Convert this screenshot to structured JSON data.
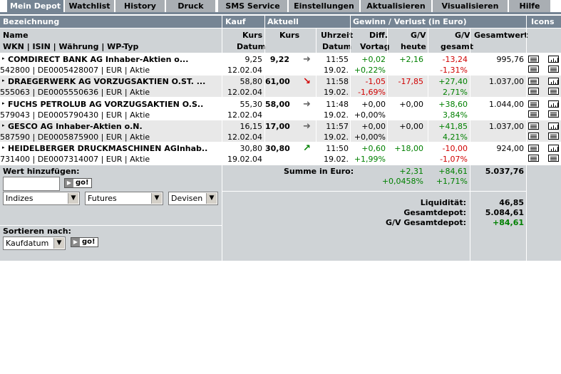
{
  "tabs": {
    "mein_depot": "Mein Depot",
    "watchlist": "Watchlist",
    "history": "History",
    "druck": "Druck",
    "sms": "SMS Service",
    "einstellungen": "Einstellungen",
    "aktualisieren": "Aktualisieren",
    "visualisieren": "Visualisieren",
    "hilfe": "Hilfe"
  },
  "header": {
    "bezeichnung": "Bezeichnung",
    "kauf": "Kauf",
    "aktuell": "Aktuell",
    "gewinn": "Gewinn / Verlust  (in Euro)",
    "icons": "Icons",
    "name": "Name",
    "wkn_line": "WKN | ISIN | Währung | WP-Typ",
    "kurs": "Kurs",
    "datum": "Datum",
    "kurs2": "Kurs",
    "uhrzeit": "Uhrzeit",
    "datum2": "Datum",
    "diff": "Diff.",
    "vortag": "Vortag",
    "gv": "G/V",
    "heute": "heute",
    "gv2": "G/V",
    "gesamt": "gesamt",
    "gesamtwert": "Gesamtwert"
  },
  "rows": [
    {
      "name": "COMDIRECT BANK AG Inhaber-Aktien o...",
      "ids": "542800 | DE0005428007 | EUR | Aktie",
      "kauf_kurs": "9,25",
      "kauf_datum": "12.02.04",
      "kurs": "9,22",
      "arrow": "right",
      "zeit": "11:55",
      "datum": "19.02.",
      "diff": "+0,02",
      "diff_pct": "+0,22%",
      "gv_heute": "+2,16",
      "gv_gesamt": "-13,24",
      "gv_pct": "-1,31%",
      "wert": "995,76"
    },
    {
      "name": "DRAEGERWERK AG VORZUGSAKTIEN O.ST. ...",
      "ids": "555063 | DE0005550636 | EUR | Aktie",
      "kauf_kurs": "58,80",
      "kauf_datum": "12.02.04",
      "kurs": "61,00",
      "arrow": "down",
      "zeit": "11:58",
      "datum": "19.02.",
      "diff": "-1,05",
      "diff_pct": "-1,69%",
      "gv_heute": "-17,85",
      "gv_gesamt": "+27,40",
      "gv_pct": "2,71%",
      "wert": "1.037,00"
    },
    {
      "name": "FUCHS PETROLUB AG VORZUGSAKTIEN O.S..",
      "ids": "579043 | DE0005790430 | EUR | Aktie",
      "kauf_kurs": "55,30",
      "kauf_datum": "12.02.04",
      "kurs": "58,00",
      "arrow": "right",
      "zeit": "11:48",
      "datum": "19.02.",
      "diff": "+0,00",
      "diff_pct": "+0,00%",
      "gv_heute": "+0,00",
      "gv_gesamt": "+38,60",
      "gv_pct": "3,84%",
      "wert": "1.044,00"
    },
    {
      "name": "GESCO AG Inhaber-Aktien o.N.",
      "ids": "587590 | DE0005875900 | EUR | Aktie",
      "kauf_kurs": "16,15",
      "kauf_datum": "12.02.04",
      "kurs": "17,00",
      "arrow": "right",
      "zeit": "11:57",
      "datum": "19.02.",
      "diff": "+0,00",
      "diff_pct": "+0,00%",
      "gv_heute": "+0,00",
      "gv_gesamt": "+41,85",
      "gv_pct": "4,21%",
      "wert": "1.037,00"
    },
    {
      "name": "HEIDELBERGER DRUCKMASCHINEN AGInhab..",
      "ids": "731400 | DE0007314007 | EUR | Aktie",
      "kauf_kurs": "30,80",
      "kauf_datum": "19.02.04",
      "kurs": "30,80",
      "arrow": "up",
      "zeit": "11:50",
      "datum": "19.02.",
      "diff": "+0,60",
      "diff_pct": "+1,99%",
      "gv_heute": "+18,00",
      "gv_gesamt": "-10,00",
      "gv_pct": "-1,07%",
      "wert": "924,00"
    }
  ],
  "summary": {
    "label": "Summe in Euro:",
    "gv_heute": "+2,31",
    "gv_heute_pct": "+0,0458%",
    "gv_gesamt": "+84,61",
    "gv_gesamt_pct": "+1,71%",
    "wert": "5.037,76",
    "liquiditaet_label": "Liquidität:",
    "liquiditaet": "46,85",
    "gesamtdepot_label": "Gesamtdepot:",
    "gesamtdepot": "5.084,61",
    "gv_gesamtdepot_label": "G/V Gesamtdepot:",
    "gv_gesamtdepot": "+84,61"
  },
  "add_value": {
    "label": "Wert hinzufügen:",
    "input_value": "",
    "go": "go!",
    "select_indizes": "Indizes",
    "select_futures": "Futures",
    "select_devisen": "Devisen"
  },
  "sort": {
    "label": "Sortieren nach:",
    "selected": "Kaufdatum",
    "go": "go!"
  },
  "colors": {
    "header_blue": "#768594",
    "panel_grey": "#cfd3d6",
    "negative": "#d00000",
    "positive": "#008000"
  }
}
